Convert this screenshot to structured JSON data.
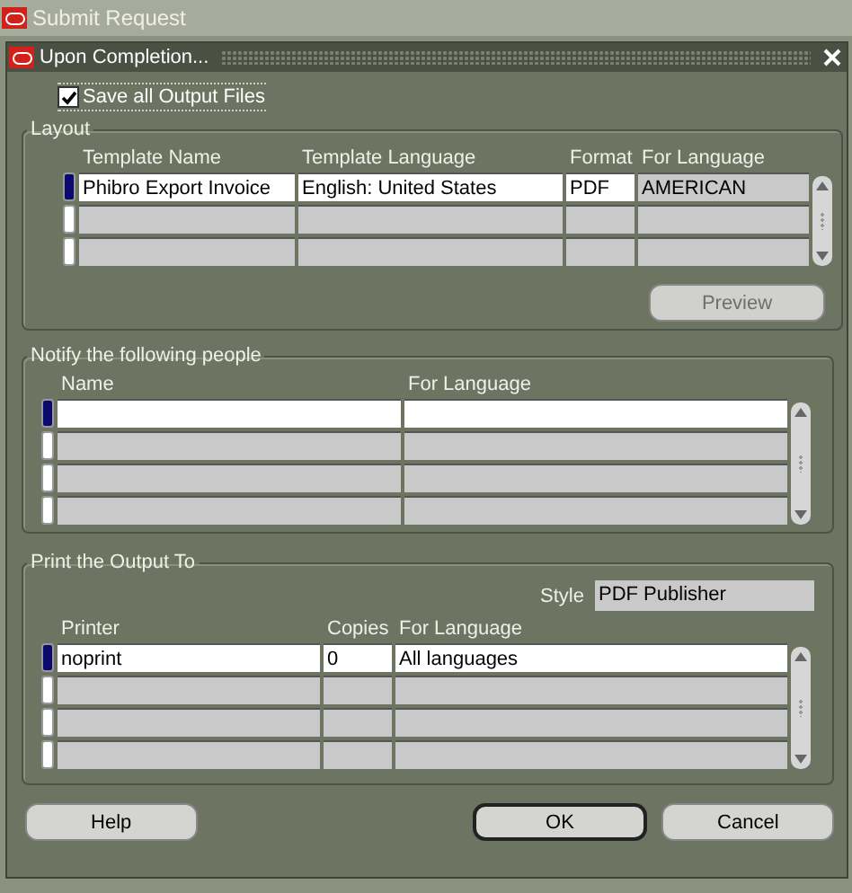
{
  "parent_window": {
    "title": "Submit Request"
  },
  "dialog": {
    "title": "Upon Completion..."
  },
  "save_all_output_files": {
    "label": "Save all Output Files",
    "checked": true
  },
  "layout": {
    "legend": "Layout",
    "columns": [
      {
        "label": "Template Name",
        "editable": true
      },
      {
        "label": "Template Language",
        "editable": true
      },
      {
        "label": "Format",
        "editable": true
      },
      {
        "label": "For Language",
        "editable": false
      }
    ],
    "rows": [
      {
        "selected": true,
        "cells": [
          "Phibro Export Invoice",
          "English: United States",
          "PDF",
          "AMERICAN"
        ]
      },
      {
        "selected": false
      },
      {
        "selected": false
      }
    ],
    "preview_button": {
      "label": "Preview",
      "disabled": true
    }
  },
  "notify": {
    "legend": "Notify the following people",
    "columns": [
      {
        "label": "Name",
        "editable": true
      },
      {
        "label": "For Language",
        "editable": true
      }
    ],
    "rows": [
      {
        "selected": true
      },
      {
        "selected": false
      },
      {
        "selected": false
      },
      {
        "selected": false
      }
    ]
  },
  "print": {
    "legend": "Print the Output To",
    "style_label": "Style",
    "style_value": "PDF Publisher",
    "columns": [
      {
        "label": "Printer",
        "editable": true
      },
      {
        "label": "Copies",
        "editable": true
      },
      {
        "label": "For Language",
        "editable": true
      }
    ],
    "rows": [
      {
        "selected": true,
        "cells": [
          "noprint",
          "0",
          "All languages"
        ]
      },
      {
        "selected": false
      },
      {
        "selected": false
      },
      {
        "selected": false
      }
    ]
  },
  "buttons": [
    {
      "label": "Help",
      "kind": "help"
    },
    {
      "label": "OK",
      "kind": "default"
    },
    {
      "label": "Cancel",
      "kind": "normal"
    }
  ]
}
